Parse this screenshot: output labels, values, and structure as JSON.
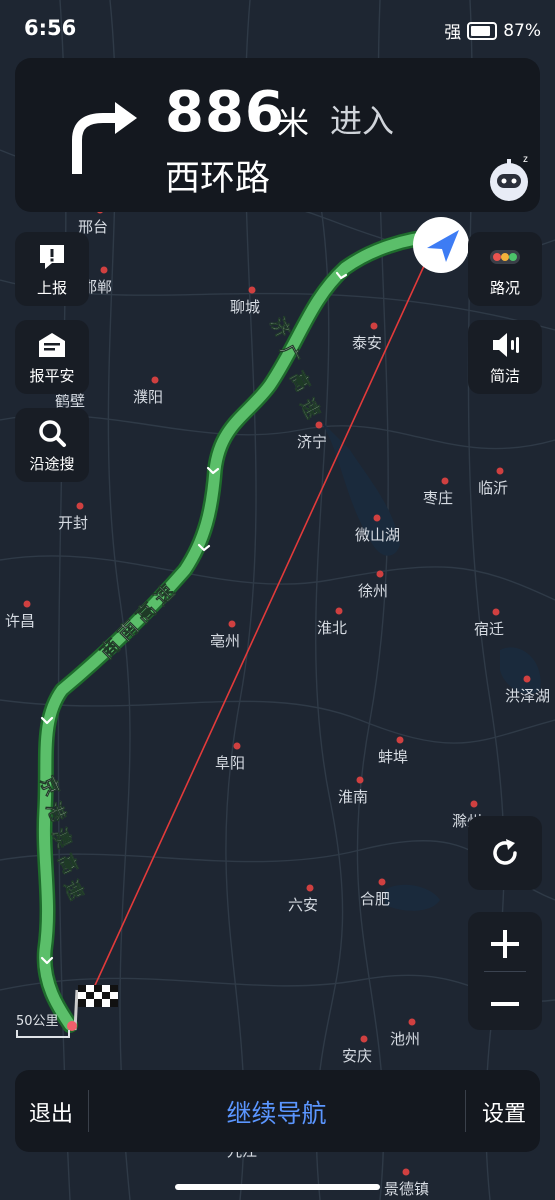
{
  "status": {
    "time": "6:56",
    "signal": "强",
    "battery": "87",
    "battery_level": 0.87
  },
  "nav": {
    "distance": "886",
    "unit": "米",
    "action": "进入",
    "road": "西环路"
  },
  "left_buttons": [
    {
      "label": "上报"
    },
    {
      "label": "报平安"
    },
    {
      "label": "沿途搜"
    }
  ],
  "right_buttons": [
    {
      "label": "路况"
    },
    {
      "label": "简洁"
    }
  ],
  "cities": [
    "邢台",
    "邯郸",
    "聊城",
    "泰安",
    "濮阳",
    "鹤壁",
    "济宁",
    "枣庄",
    "临沂",
    "开封",
    "微山湖",
    "徐州",
    "许昌",
    "亳州",
    "淮北",
    "宿迁",
    "洪泽湖",
    "阜阳",
    "蚌埠",
    "淮南",
    "滁州",
    "合肥",
    "六安",
    "安庆",
    "池州",
    "九江",
    "景德镇"
  ],
  "roads": [
    "济广高速",
    "商南高速",
    "京港澳高速"
  ],
  "scale": "50公里",
  "bottom": {
    "exit": "退出",
    "continue": "继续导航",
    "settings": "设置"
  },
  "colors": {
    "route": "#5bbf6a",
    "accent": "#5b96ff",
    "line": "#e23a3a",
    "card": "#14181f"
  }
}
